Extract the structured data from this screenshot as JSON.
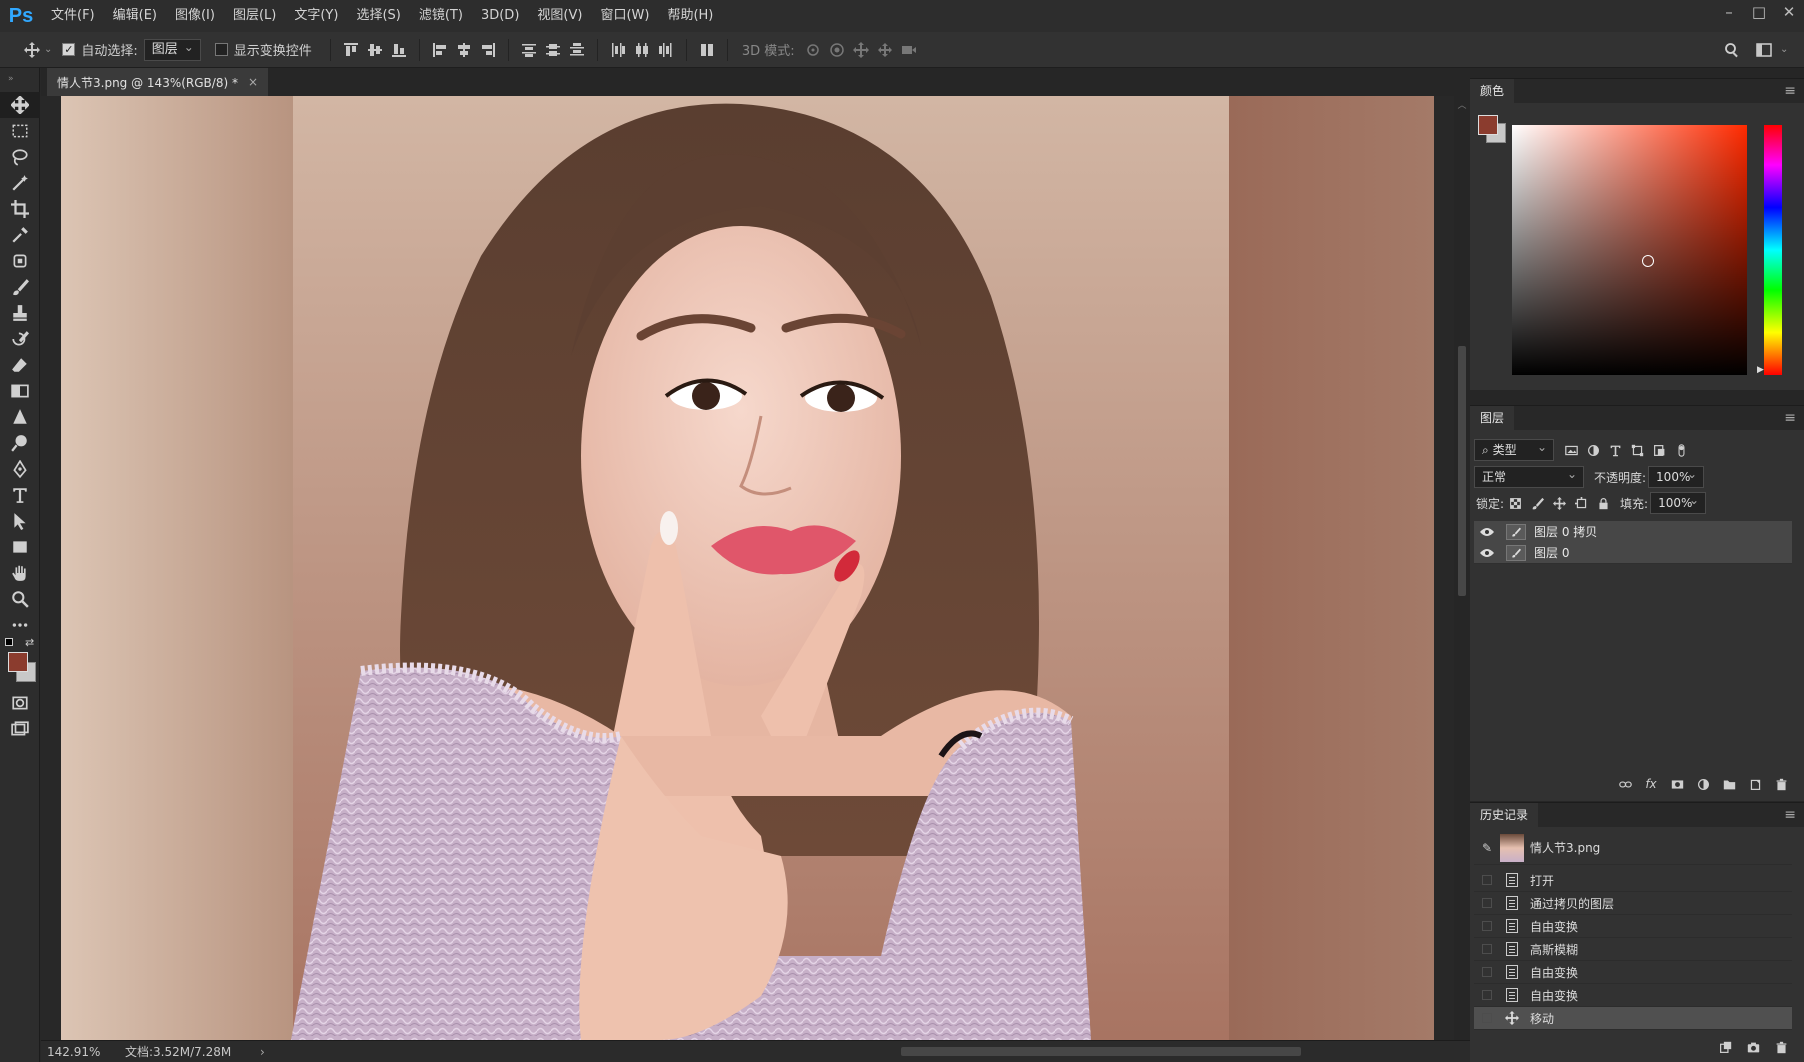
{
  "menubar": {
    "logo": "Ps",
    "items": [
      "文件(F)",
      "编辑(E)",
      "图像(I)",
      "图层(L)",
      "文字(Y)",
      "选择(S)",
      "滤镜(T)",
      "3D(D)",
      "视图(V)",
      "窗口(W)",
      "帮助(H)"
    ]
  },
  "window": {
    "minimize": "–",
    "maximize": "□",
    "close": "✕"
  },
  "options": {
    "auto_select_label": "自动选择:",
    "auto_select_checked": true,
    "target_select": "图层",
    "show_transform_label": "显示变换控件",
    "show_transform_checked": false,
    "mode3d_label": "3D 模式:"
  },
  "document": {
    "tab_title": "情人节3.png @ 143%(RGB/8) *",
    "tab_close": "×"
  },
  "status": {
    "zoom": "142.91%",
    "doc_size": "文档:3.52M/7.28M",
    "arrow": "›"
  },
  "color_panel": {
    "title": "颜色",
    "foreground": "#8b3c2e",
    "background": "#c8c8c8"
  },
  "layers_panel": {
    "title": "图层",
    "filter_select": "类型",
    "blend_mode": "正常",
    "opacity_label": "不透明度:",
    "opacity_value": "100%",
    "lock_label": "锁定:",
    "fill_label": "填充:",
    "fill_value": "100%",
    "layers": [
      {
        "name": "图层 0 拷贝"
      },
      {
        "name": "图层 0"
      }
    ]
  },
  "history_panel": {
    "title": "历史记录",
    "snapshot": "情人节3.png",
    "steps": [
      "打开",
      "通过拷贝的图层",
      "自由变换",
      "高斯模糊",
      "自由变换",
      "自由变换",
      "移动"
    ]
  }
}
